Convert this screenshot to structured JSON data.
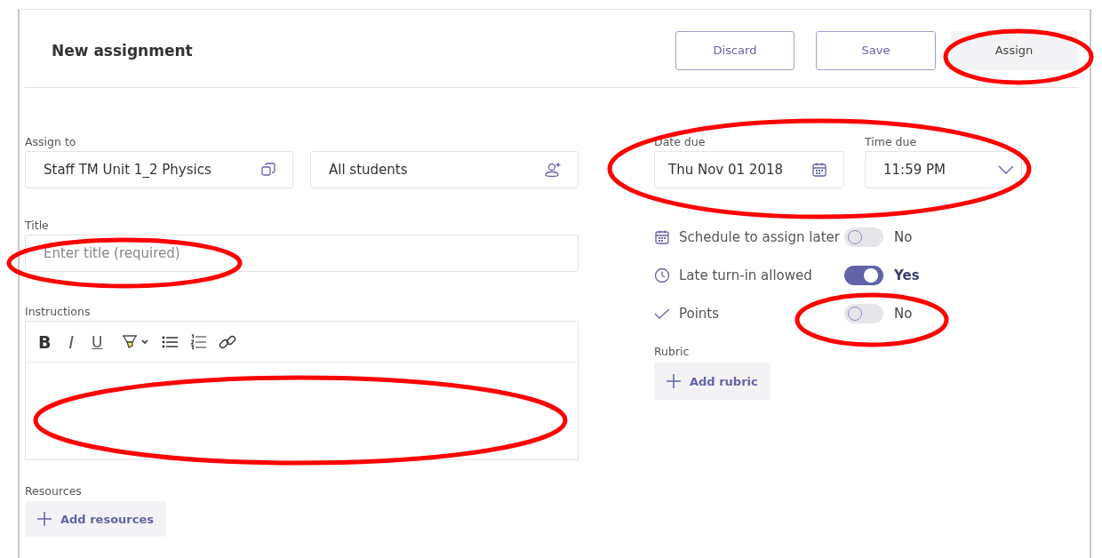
{
  "header": {
    "title": "New assignment",
    "buttons": [
      {
        "label": "Discard",
        "kind": "outline"
      },
      {
        "label": "Save",
        "kind": "outline"
      },
      {
        "label": "Assign",
        "kind": "filled"
      }
    ]
  },
  "assign_to": {
    "label": "Assign to",
    "class_field": {
      "value": "Staff TM Unit 1_2 Physics"
    },
    "students_field": {
      "value": "All students"
    }
  },
  "title": {
    "label": "Title",
    "placeholder": "Enter title (required)"
  },
  "instructions": {
    "label": "Instructions",
    "toolbar": [
      {
        "kind": "bold",
        "label": "B"
      },
      {
        "kind": "italic",
        "label": "I"
      },
      {
        "kind": "underline",
        "label": "U"
      },
      {
        "kind": "highlight"
      },
      {
        "kind": "bullets"
      },
      {
        "kind": "numbered"
      },
      {
        "kind": "link"
      }
    ]
  },
  "resources": {
    "label": "Resources",
    "button": "Add resources"
  },
  "date_due": {
    "label": "Date due",
    "value": "Thu Nov 01 2018"
  },
  "time_due": {
    "label": "Time due",
    "value": "11:59 PM"
  },
  "options": [
    {
      "kind": "calendar",
      "label": "Schedule to assign later",
      "on": false,
      "value": "No"
    },
    {
      "kind": "clock",
      "label": "Late turn-in allowed",
      "on": true,
      "value": "Yes"
    },
    {
      "kind": "check",
      "label": "Points",
      "on": false,
      "value": "No"
    }
  ],
  "rubric": {
    "label": "Rubric",
    "button": "Add rubric"
  }
}
